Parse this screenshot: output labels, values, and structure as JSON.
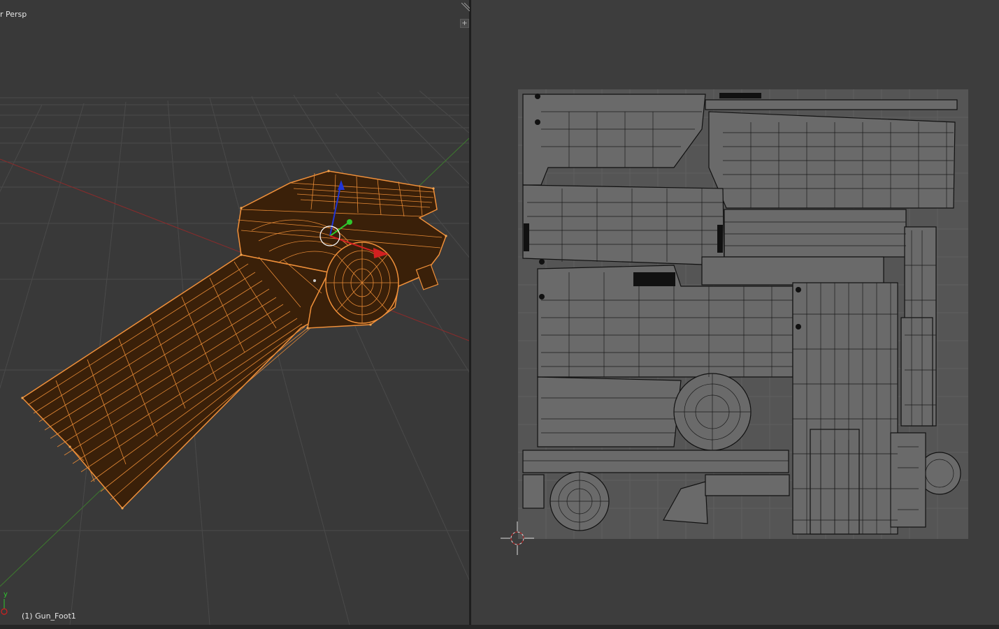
{
  "viewport_3d": {
    "view_name": "r Persp",
    "active_object": "(1) Gun_Foot1",
    "axis_label_y": "y",
    "colors": {
      "background": "#393939",
      "grid": "#4a4a4a",
      "x_axis": "#8a2b2b",
      "y_axis": "#3d7a2e",
      "wire_selected": "#f0903a",
      "mesh_fill": "#3a2009",
      "gizmo_z": "#1f35d8",
      "gizmo_y": "#2ec82e",
      "gizmo_x": "#d12020"
    },
    "icons": [
      "transform-gizmo-icon",
      "3d-cursor-icon",
      "axis-orientation-icon"
    ]
  },
  "uv_editor": {
    "colors": {
      "background": "#3d3d3d",
      "texture_area": "#555555",
      "texture_grid": "#5e5e5e",
      "uv_edges": "#111111",
      "uv_faces": "#6a6a6a"
    },
    "icons": [
      "2d-cursor-icon"
    ]
  },
  "area_split": {
    "icons": [
      "area-split-plus-icon",
      "area-split-plus-icon",
      "area-corner-icon"
    ]
  }
}
